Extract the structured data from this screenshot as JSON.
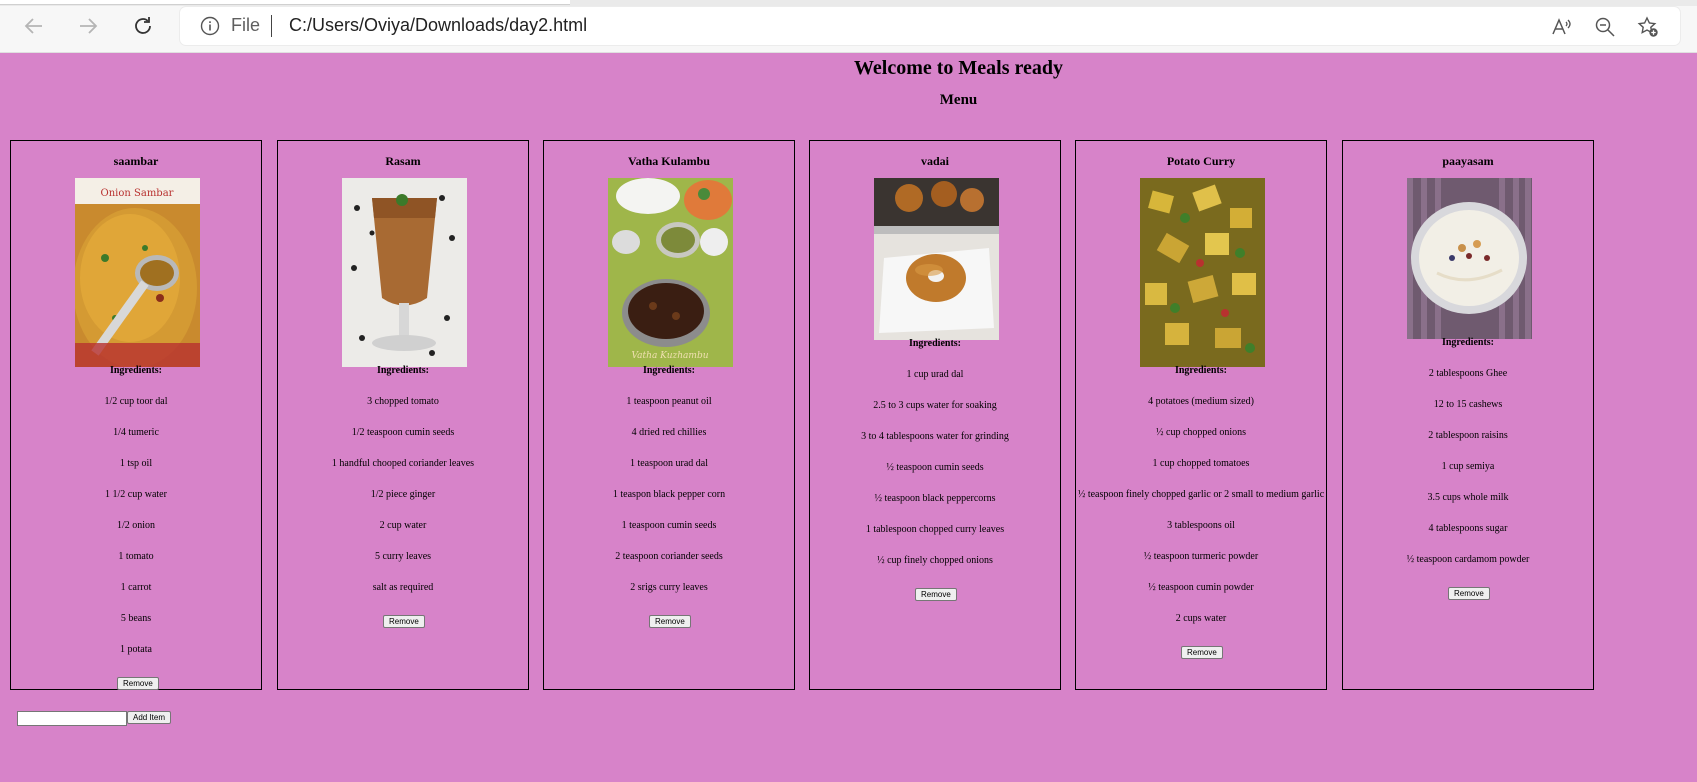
{
  "browser": {
    "protocol_label": "File",
    "url": "C:/Users/Oviya/Downloads/day2.html"
  },
  "page": {
    "title": "Welcome to Meals ready",
    "subtitle": "Menu",
    "ingredients_heading": "Ingredients:",
    "remove_label": "Remove",
    "add_item_label": "Add Item",
    "add_item_value": ""
  },
  "meals": [
    {
      "name": "saambar",
      "image": "onion-sambar-photo",
      "image_caption": "Onion Sambar",
      "ingredients": [
        "1/2 cup toor dal",
        "1/4 tumeric",
        "1 tsp oil",
        "1 1/2 cup water",
        "1/2 onion",
        "1 tomato",
        "1 carrot",
        "5 beans",
        "1 potata"
      ]
    },
    {
      "name": "Rasam",
      "image": "rasam-glass-photo",
      "ingredients": [
        "3 chopped tomato",
        "1/2 teaspoon cumin seeds",
        "1 handful chooped coriander leaves",
        "1/2 piece ginger",
        "2 cup water",
        "5 curry leaves",
        "salt as required"
      ]
    },
    {
      "name": "Vatha Kulambu",
      "image": "vatha-kulambu-photo",
      "image_caption": "Vatha Kuzhambu",
      "ingredients": [
        "1 teaspoon peanut oil",
        "4 dried red chillies",
        "1 teaspoon urad dal",
        "1 teaspon black pepper corn",
        "1 teaspoon cumin seeds",
        "2 teaspoon coriander seeds",
        "2 srigs curry leaves"
      ]
    },
    {
      "name": "vadai",
      "image": "medu-vadai-photo",
      "ingredients": [
        "1 cup urad dal",
        "2.5 to 3 cups water for soaking",
        "3 to 4 tablespoons water for grinding",
        "½ teaspoon cumin seeds",
        "½ teaspoon black peppercorns",
        "1 tablespoon chopped curry leaves",
        "½ cup finely chopped onions"
      ]
    },
    {
      "name": "Potato Curry",
      "image": "potato-curry-photo",
      "ingredients": [
        "4 potatoes (medium sized)",
        "½ cup chopped onions",
        "1 cup chopped tomatoes",
        "½ teaspoon finely chopped garlic or 2 small to medium garlic",
        "3 tablespoons oil",
        "½ teaspoon turmeric powder",
        "½ teaspoon cumin powder",
        "2 cups water"
      ]
    },
    {
      "name": "paayasam",
      "image": "payasam-bowl-photo",
      "ingredients": [
        "2 tablespoons Ghee",
        "12 to 15 cashews",
        "2 tablespoon raisins",
        "1 cup semiya",
        "3.5 cups whole milk",
        "4 tablespoons sugar",
        "½ teaspoon cardamom powder"
      ]
    }
  ]
}
